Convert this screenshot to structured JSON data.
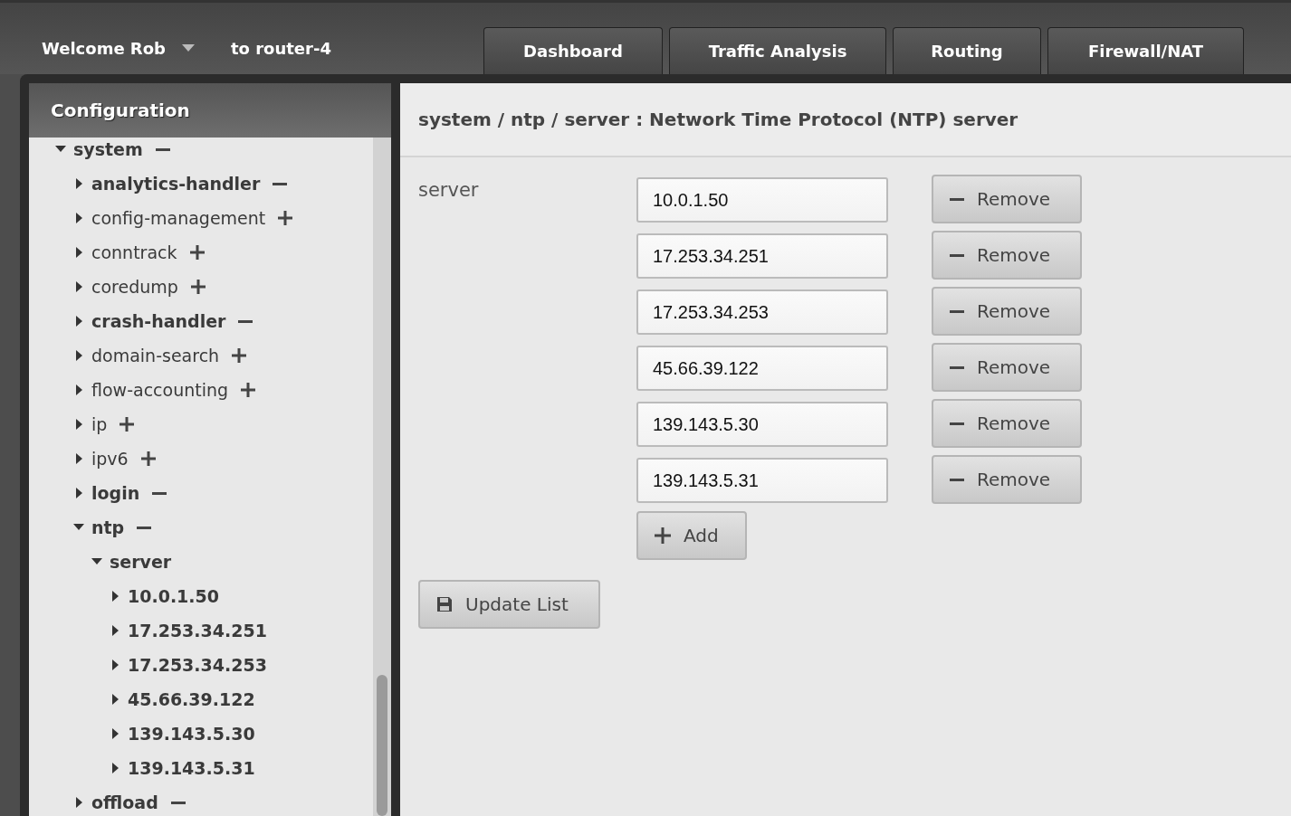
{
  "header": {
    "user": "Welcome Rob",
    "device": "to router-4"
  },
  "tabs": [
    {
      "label": "Dashboard"
    },
    {
      "label": "Traffic Analysis"
    },
    {
      "label": "Routing"
    },
    {
      "label": "Firewall/NAT"
    }
  ],
  "sidebar": {
    "title": "Configuration",
    "tree": [
      {
        "label": "system",
        "configured": true,
        "expanded": true,
        "children": [
          {
            "label": "analytics-handler",
            "configured": true,
            "expanded": false
          },
          {
            "label": "config-management",
            "configured": false,
            "expanded": false
          },
          {
            "label": "conntrack",
            "configured": false,
            "expanded": false
          },
          {
            "label": "coredump",
            "configured": false,
            "expanded": false
          },
          {
            "label": "crash-handler",
            "configured": true,
            "expanded": false
          },
          {
            "label": "domain-search",
            "configured": false,
            "expanded": false
          },
          {
            "label": "flow-accounting",
            "configured": false,
            "expanded": false
          },
          {
            "label": "ip",
            "configured": false,
            "expanded": false
          },
          {
            "label": "ipv6",
            "configured": false,
            "expanded": false
          },
          {
            "label": "login",
            "configured": true,
            "expanded": false
          },
          {
            "label": "ntp",
            "configured": true,
            "expanded": true,
            "children": [
              {
                "label": "server",
                "kind": "node",
                "expanded": true,
                "children": [
                  {
                    "label": "10.0.1.50",
                    "kind": "node",
                    "expanded": false
                  },
                  {
                    "label": "17.253.34.251",
                    "kind": "node",
                    "expanded": false
                  },
                  {
                    "label": "17.253.34.253",
                    "kind": "node",
                    "expanded": false
                  },
                  {
                    "label": "45.66.39.122",
                    "kind": "node",
                    "expanded": false
                  },
                  {
                    "label": "139.143.5.30",
                    "kind": "node",
                    "expanded": false
                  },
                  {
                    "label": "139.143.5.31",
                    "kind": "node",
                    "expanded": false
                  }
                ]
              }
            ]
          },
          {
            "label": "offload",
            "configured": true,
            "expanded": false
          }
        ]
      }
    ]
  },
  "content": {
    "title": "system / ntp / server : Network Time Protocol (NTP) server",
    "field_label": "server",
    "servers": [
      {
        "value": "10.0.1.50",
        "remove_label": "Remove"
      },
      {
        "value": "17.253.34.251",
        "remove_label": "Remove"
      },
      {
        "value": "17.253.34.253",
        "remove_label": "Remove"
      },
      {
        "value": "45.66.39.122",
        "remove_label": "Remove"
      },
      {
        "value": "139.143.5.30",
        "remove_label": "Remove"
      },
      {
        "value": "139.143.5.31",
        "remove_label": "Remove"
      }
    ],
    "add_label": "Add",
    "update_label": "Update List"
  }
}
